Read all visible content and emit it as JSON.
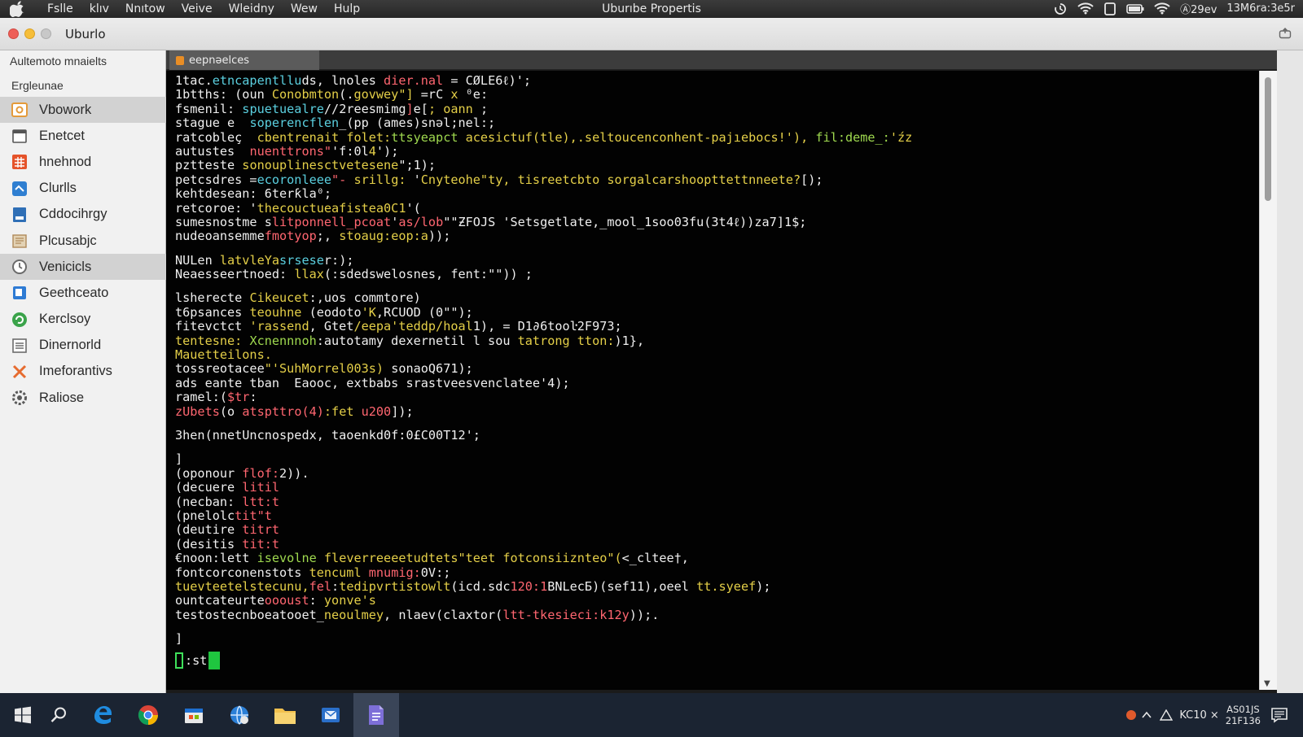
{
  "menubar": {
    "items": [
      "Fslle",
      "klıv",
      "Nnıtow",
      "Veive",
      "Wleidny",
      "Wew",
      "Hulp"
    ],
    "title": "Uburıbe Propertis",
    "battery_text": "Ⓐ29ev",
    "clock_text": "13M6ra:3e5r"
  },
  "window": {
    "title": "Uburlo"
  },
  "sidebar": {
    "section1": "Aultemoto mnaielts",
    "section2": "Ergleunae",
    "items": [
      {
        "label": "Vbowork",
        "icon": "gear-folder-icon",
        "color": "#e49a3a",
        "selected": true
      },
      {
        "label": "Enetcet",
        "icon": "calendar-icon",
        "color": "#555555",
        "selected": false
      },
      {
        "label": "hnehnod",
        "icon": "grid-app-icon",
        "color": "#e5532a",
        "selected": false
      },
      {
        "label": "Clurlls",
        "icon": "cloud-sync-icon",
        "color": "#2f7fd1",
        "selected": false
      },
      {
        "label": "Cddocihrgy",
        "icon": "document-icon",
        "color": "#2f6fb6",
        "selected": false
      },
      {
        "label": "Plcusabjc",
        "icon": "package-icon",
        "color": "#b08a5a",
        "selected": false
      },
      {
        "label": "Venicicls",
        "icon": "clock-icon",
        "color": "#6a6a6a",
        "selected": true
      },
      {
        "label": "Geethceato",
        "icon": "notes-icon",
        "color": "#2e7bd4",
        "selected": false
      },
      {
        "label": "Kerclsoy",
        "icon": "refresh-icon",
        "color": "#3aa34a",
        "selected": false
      },
      {
        "label": "Dinernorld",
        "icon": "list-icon",
        "color": "#6c6c6c",
        "selected": false
      },
      {
        "label": "Imeforantivs",
        "icon": "cross-tools-icon",
        "color": "#e66b2f",
        "selected": false
      },
      {
        "label": "Raliose",
        "icon": "settings-gear-icon",
        "color": "#5a5a5a",
        "selected": false
      }
    ]
  },
  "terminal": {
    "tab_label": "eepnəelces",
    "lines": [
      [
        [
          "w",
          "1tac."
        ],
        [
          "c",
          "etncapentllu"
        ],
        [
          "w",
          "ds, lnoles "
        ],
        [
          "r",
          "dier.nal"
        ],
        [
          "w",
          " = C"
        ],
        [
          "w",
          "ØLE6ℓ)';"
        ]
      ],
      [
        [
          "w",
          "1btths: "
        ],
        [
          "w",
          "(oun "
        ],
        [
          "y",
          "Conobmton"
        ],
        [
          "w",
          "(."
        ],
        [
          "y",
          "govwey\"]"
        ],
        [
          "w",
          " ="
        ],
        [
          "w",
          "rC "
        ],
        [
          "y",
          "x"
        ],
        [
          "w",
          " ⁰e:"
        ]
      ],
      [
        [
          "w",
          "fsmenil: "
        ],
        [
          "c",
          "spuetuealre"
        ],
        [
          "w",
          "//"
        ],
        [
          "w",
          "2reesmimg"
        ],
        [
          "r",
          "]"
        ],
        [
          "w",
          "e["
        ],
        [
          "y",
          "; oann"
        ],
        [
          "w",
          " ;"
        ]
      ],
      [
        [
          "w",
          "stague e  "
        ],
        [
          "c",
          "soperencflen"
        ],
        [
          "w",
          "_(pp "
        ],
        [
          "w",
          "(ames)"
        ],
        [
          "w",
          "snəl;nel:;"
        ]
      ],
      [
        [
          "w",
          "ratcobleç  "
        ],
        [
          "y",
          "cbentrenait folet:"
        ],
        [
          "g",
          "ttsyeapct"
        ],
        [
          "y",
          " acesictuf(tle),.seltoucenconhent-pajıebocs!'),"
        ],
        [
          "g",
          " fil:deme_:"
        ],
        [
          "y",
          "'źz"
        ]
      ],
      [
        [
          "w",
          "autustes  "
        ],
        [
          "r",
          "nuenttrons\""
        ],
        [
          "w",
          "'f:0l"
        ],
        [
          "y",
          "4"
        ],
        [
          "w",
          "');"
        ]
      ],
      [
        [
          "w",
          "pztteste "
        ],
        [
          "y",
          "sonouplinesctvetesene"
        ],
        [
          "w",
          "\";1);"
        ]
      ],
      [
        [
          "w",
          "petcsdres ="
        ],
        [
          "c",
          "ecoronleee"
        ],
        [
          "r",
          "\"-"
        ],
        [
          "y",
          " srillg:"
        ],
        [
          "w",
          " '"
        ],
        [
          "y",
          "Cnyteohe\"ty, tisreetcbto sorgalcarshoopttettnneete?"
        ],
        [
          "w",
          "[);"
        ]
      ],
      [
        [
          "w",
          "kehtdesean: "
        ],
        [
          "w",
          "6terƙla⁰;"
        ]
      ],
      [
        [
          "w",
          "retcoroe: '"
        ],
        [
          "y",
          "thecouctueafistea0C1"
        ],
        [
          "w",
          "'("
        ]
      ],
      [
        [
          "w",
          "sumesnostme "
        ],
        [
          "w",
          "s"
        ],
        [
          "r",
          "litponnell_pcoat"
        ],
        [
          "w",
          "'"
        ],
        [
          "r",
          "as/lob"
        ],
        [
          "w",
          "\"\"ƵFOJS "
        ],
        [
          "w",
          "'Setsgetlate,_mool_1soo03fu(3t4ℓ))za7]1$;"
        ]
      ],
      [
        [
          "w",
          "nudeoansemme"
        ],
        [
          "r",
          "fmotyop"
        ],
        [
          "w",
          ";, "
        ],
        [
          "y",
          "stoaug:eop:a"
        ],
        [
          "w",
          "));"
        ]
      ],
      "GAP",
      [
        [
          "w",
          "NULen "
        ],
        [
          "y",
          "latvleYa"
        ],
        [
          "c",
          "srsese"
        ],
        [
          "w",
          "r:);"
        ]
      ],
      [
        [
          "w",
          "Neaesseertnoed: "
        ],
        [
          "y",
          "llax"
        ],
        [
          "w",
          "("
        ],
        [
          "w",
          ":sdedswelosnes, fent:\"\")) ;"
        ]
      ],
      "GAP",
      [
        [
          "w",
          "lsherecte "
        ],
        [
          "y",
          "Cikeucet"
        ],
        [
          "w",
          ":,uos commtore)"
        ]
      ],
      [
        [
          "w",
          "t6psances "
        ],
        [
          "y",
          "teouhne"
        ],
        [
          "w",
          " (eodoto"
        ],
        [
          "y",
          "'K"
        ],
        [
          "w",
          ",RCUOD (0\"\");"
        ]
      ],
      [
        [
          "w",
          "fitevctct"
        ],
        [
          "y",
          " 'rassend"
        ],
        [
          "w",
          ", Gtet"
        ],
        [
          "y",
          "/eepa'teddp/hoal"
        ],
        [
          "w",
          "1), = D1∂6tooŀ2F973;"
        ]
      ],
      [
        [
          "y",
          "tentesne: "
        ],
        [
          "g",
          "Xcnennnoh"
        ],
        [
          "w",
          ":autotamy dexernetil "
        ],
        [
          "w",
          "l sou "
        ],
        [
          "y",
          "tatrong tton:"
        ],
        [
          "w",
          ")1},"
        ]
      ],
      [
        [
          "y",
          "Mauetteilons."
        ]
      ],
      [
        [
          "w",
          "tossreotacee"
        ],
        [
          "y",
          "\"'SuhMorrel003s) "
        ],
        [
          "w",
          "sonaoQ671);"
        ]
      ],
      [
        [
          "w",
          "ads eante tban  Eaooc, extbabs srastveesvenclatee'4);"
        ]
      ],
      [
        [
          "w",
          "ramel:("
        ],
        [
          "r",
          "$tr"
        ],
        [
          "w",
          ":"
        ]
      ],
      [
        [
          "r",
          "zUbets"
        ],
        [
          "w",
          "(o "
        ],
        [
          "r",
          "atspttro(4)"
        ],
        [
          "y",
          ":fet"
        ],
        [
          "r",
          " u200"
        ],
        [
          "w",
          "]);"
        ]
      ],
      "GAP",
      [
        [
          "w",
          "3hen(nnetUncnospedx, taoenkd0f:0£C00T12';"
        ]
      ],
      "GAP",
      [
        [
          "w",
          "]"
        ]
      ],
      [
        [
          "w",
          "(oponour "
        ],
        [
          "r",
          "flof:"
        ],
        [
          "w",
          "2))."
        ]
      ],
      [
        [
          "w",
          "(decuere "
        ],
        [
          "r",
          "litil"
        ]
      ],
      [
        [
          "w",
          "(necban: "
        ],
        [
          "r",
          "ltt:t"
        ]
      ],
      [
        [
          "w",
          "(pnelolc"
        ],
        [
          "r",
          "tit\"t"
        ]
      ],
      [
        [
          "w",
          "(deutire "
        ],
        [
          "r",
          "titrt"
        ]
      ],
      [
        [
          "w",
          "(desitis "
        ],
        [
          "r",
          "tit:t"
        ]
      ],
      [
        [
          "w",
          "€noon:lett "
        ],
        [
          "g",
          "isevolne"
        ],
        [
          "w",
          " "
        ],
        [
          "y",
          "fleverreeeetudtets\"teet fotconsiiznteo\"("
        ],
        [
          "w",
          "<_cltee†,"
        ]
      ],
      [
        [
          "w",
          "fontcorconenstots "
        ],
        [
          "y",
          "tencuml"
        ],
        [
          "w",
          " "
        ],
        [
          "r",
          "mnumig:"
        ],
        [
          "w",
          "0V:;"
        ]
      ],
      [
        [
          "y",
          "tuevteetelstecunu,"
        ],
        [
          "r",
          "fel"
        ],
        [
          "w",
          ":"
        ],
        [
          "y",
          "tedipvrtistowlt"
        ],
        [
          "w",
          "(icd.sdc"
        ],
        [
          "r",
          "120:1"
        ],
        [
          "w",
          "BNLecƂ)(sef11),oeel "
        ],
        [
          "y",
          "tt.syeef"
        ],
        [
          "w",
          ");"
        ]
      ],
      [
        [
          "w",
          "ountcateurte"
        ],
        [
          "r",
          "oooust"
        ],
        [
          "w",
          ": "
        ],
        [
          "y",
          "yonve's"
        ]
      ],
      [
        [
          "w",
          "testostecnboeatooet_"
        ],
        [
          "y",
          "neoulmey"
        ],
        [
          "w",
          ", nlaev(claxtor("
        ],
        [
          "r",
          "ltt-tkesieci:k12y"
        ],
        [
          "w",
          "));."
        ]
      ],
      "GAP",
      [
        [
          "w",
          "]"
        ]
      ]
    ],
    "prompt": ":st"
  },
  "taskbar": {
    "tray_text": "KC10 ×",
    "clock_line1": "AS01JS",
    "clock_line2": "21F136"
  }
}
